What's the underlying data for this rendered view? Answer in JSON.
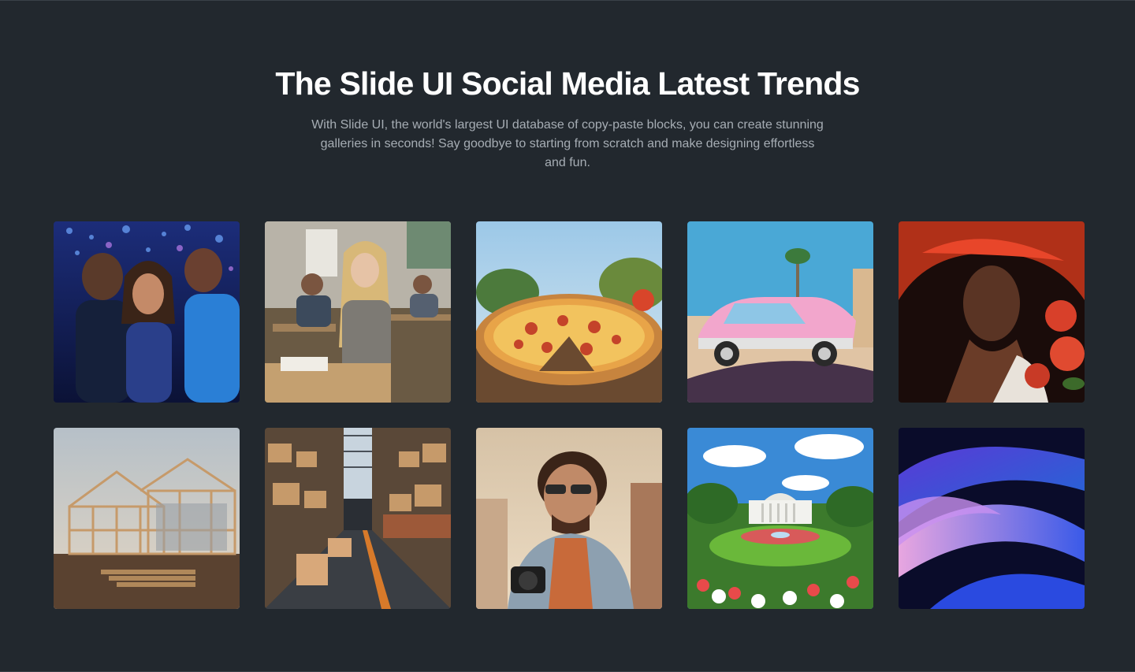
{
  "header": {
    "title": "The Slide UI Social Media Latest Trends",
    "description": "With Slide UI, the world's largest UI database of copy-paste blocks, you can create stunning galleries in seconds! Say goodbye to starting from scratch and make designing effortless and fun."
  },
  "colors": {
    "background": "#22282e",
    "title": "#ffffff",
    "description": "#a6adb4"
  }
}
